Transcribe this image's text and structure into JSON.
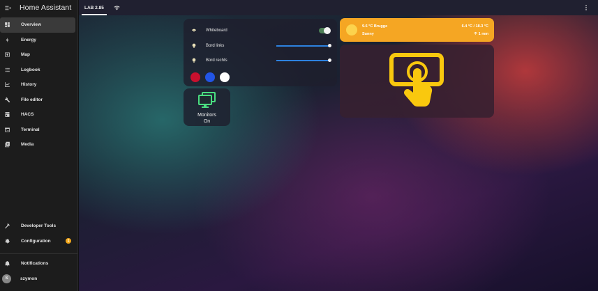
{
  "app": {
    "title": "Home Assistant"
  },
  "sidebar": {
    "items": [
      {
        "label": "Overview",
        "icon": "dashboard-icon",
        "active": true
      },
      {
        "label": "Energy",
        "icon": "lightning-icon"
      },
      {
        "label": "Map",
        "icon": "map-icon"
      },
      {
        "label": "Logbook",
        "icon": "list-icon"
      },
      {
        "label": "History",
        "icon": "chart-icon"
      },
      {
        "label": "File editor",
        "icon": "wrench-icon"
      },
      {
        "label": "HACS",
        "icon": "hacs-icon"
      },
      {
        "label": "Terminal",
        "icon": "terminal-icon"
      },
      {
        "label": "Media",
        "icon": "media-icon"
      }
    ],
    "developer_tools": "Developer Tools",
    "configuration": "Configuration",
    "configuration_badge": "1",
    "notifications": "Notifications",
    "user": {
      "name": "szymon",
      "initial": "S"
    }
  },
  "topbar": {
    "tab_label": "LAB 2.85"
  },
  "entities": {
    "items": [
      {
        "name": "Whiteboard",
        "icon": "ceiling-light-icon",
        "control": "toggle",
        "state": "on"
      },
      {
        "name": "Bord links",
        "icon": "bulb-icon",
        "control": "slider",
        "level": 1.0
      },
      {
        "name": "Bord rechts",
        "icon": "bulb-icon",
        "control": "slider",
        "level": 1.0
      }
    ],
    "swatches": [
      "#c8102e",
      "#2255e6",
      "#ffffff"
    ]
  },
  "monitor": {
    "name": "Monitors",
    "state": "On",
    "icon": "monitor-icon",
    "color": "#4ade80"
  },
  "weather": {
    "line1": "9.6 °C Brugge",
    "line2": "Sunny",
    "temps": "6.4 °C / 18.3 °C",
    "precip": "☂ 1 mm",
    "color": "#f5a623"
  },
  "touch_card": {
    "icon": "touch-screen-icon",
    "color": "#f9c80e"
  }
}
